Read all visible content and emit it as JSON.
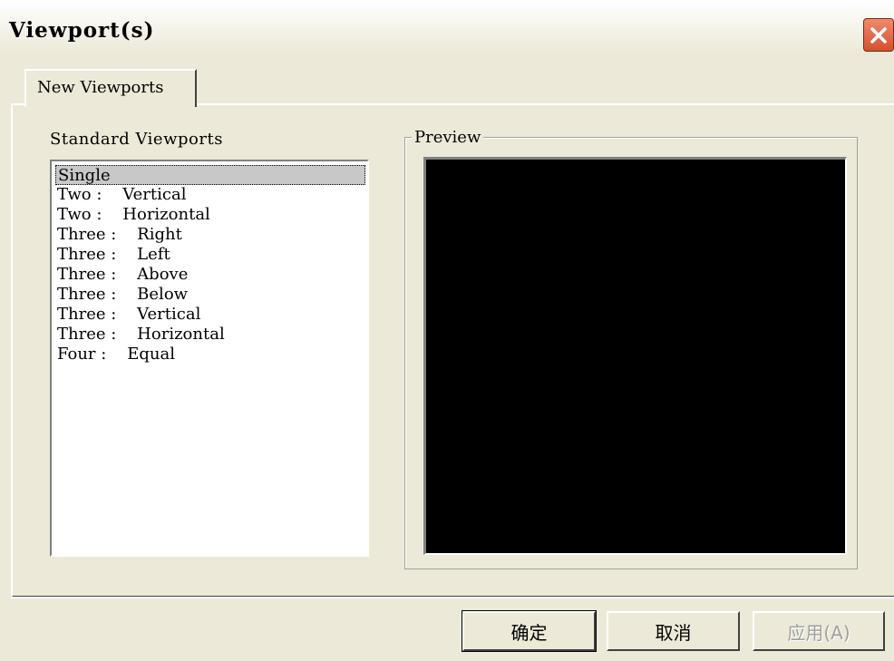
{
  "window": {
    "title": "Viewport(s)"
  },
  "tabs": [
    {
      "label": "New Viewports"
    }
  ],
  "standard": {
    "label": "Standard Viewports",
    "items": [
      "Single",
      "Two :    Vertical",
      "Two :    Horizontal",
      "Three :    Right",
      "Three :    Left",
      "Three :    Above",
      "Three :    Below",
      "Three :    Vertical",
      "Three :    Horizontal",
      "Four :    Equal"
    ],
    "selected_index": 0
  },
  "preview": {
    "label": "Preview"
  },
  "buttons": {
    "ok": "确定",
    "cancel": "取消",
    "apply": "应用(A)"
  },
  "icons": {
    "close": "close-icon"
  }
}
